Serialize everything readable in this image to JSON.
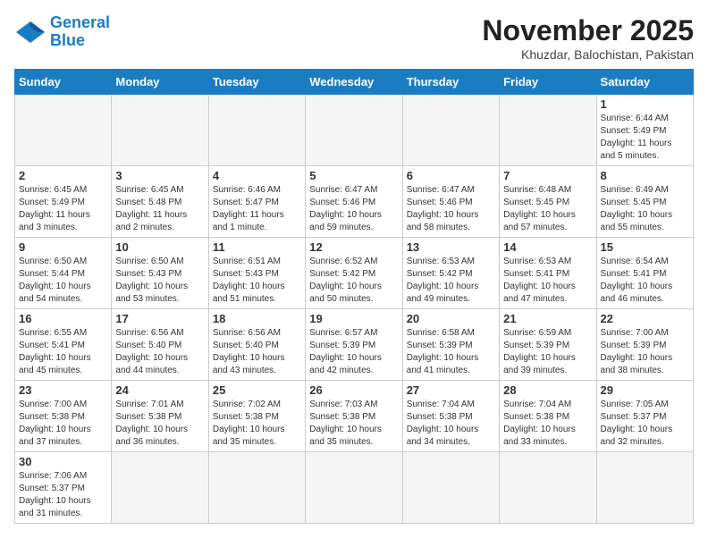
{
  "header": {
    "logo_general": "General",
    "logo_blue": "Blue",
    "month_title": "November 2025",
    "location": "Khuzdar, Balochistan, Pakistan"
  },
  "weekdays": [
    "Sunday",
    "Monday",
    "Tuesday",
    "Wednesday",
    "Thursday",
    "Friday",
    "Saturday"
  ],
  "weeks": [
    [
      {
        "day": "",
        "info": ""
      },
      {
        "day": "",
        "info": ""
      },
      {
        "day": "",
        "info": ""
      },
      {
        "day": "",
        "info": ""
      },
      {
        "day": "",
        "info": ""
      },
      {
        "day": "",
        "info": ""
      },
      {
        "day": "1",
        "info": "Sunrise: 6:44 AM\nSunset: 5:49 PM\nDaylight: 11 hours\nand 5 minutes."
      }
    ],
    [
      {
        "day": "2",
        "info": "Sunrise: 6:45 AM\nSunset: 5:49 PM\nDaylight: 11 hours\nand 3 minutes."
      },
      {
        "day": "3",
        "info": "Sunrise: 6:45 AM\nSunset: 5:48 PM\nDaylight: 11 hours\nand 2 minutes."
      },
      {
        "day": "4",
        "info": "Sunrise: 6:46 AM\nSunset: 5:47 PM\nDaylight: 11 hours\nand 1 minute."
      },
      {
        "day": "5",
        "info": "Sunrise: 6:47 AM\nSunset: 5:46 PM\nDaylight: 10 hours\nand 59 minutes."
      },
      {
        "day": "6",
        "info": "Sunrise: 6:47 AM\nSunset: 5:46 PM\nDaylight: 10 hours\nand 58 minutes."
      },
      {
        "day": "7",
        "info": "Sunrise: 6:48 AM\nSunset: 5:45 PM\nDaylight: 10 hours\nand 57 minutes."
      },
      {
        "day": "8",
        "info": "Sunrise: 6:49 AM\nSunset: 5:45 PM\nDaylight: 10 hours\nand 55 minutes."
      }
    ],
    [
      {
        "day": "9",
        "info": "Sunrise: 6:50 AM\nSunset: 5:44 PM\nDaylight: 10 hours\nand 54 minutes."
      },
      {
        "day": "10",
        "info": "Sunrise: 6:50 AM\nSunset: 5:43 PM\nDaylight: 10 hours\nand 53 minutes."
      },
      {
        "day": "11",
        "info": "Sunrise: 6:51 AM\nSunset: 5:43 PM\nDaylight: 10 hours\nand 51 minutes."
      },
      {
        "day": "12",
        "info": "Sunrise: 6:52 AM\nSunset: 5:42 PM\nDaylight: 10 hours\nand 50 minutes."
      },
      {
        "day": "13",
        "info": "Sunrise: 6:53 AM\nSunset: 5:42 PM\nDaylight: 10 hours\nand 49 minutes."
      },
      {
        "day": "14",
        "info": "Sunrise: 6:53 AM\nSunset: 5:41 PM\nDaylight: 10 hours\nand 47 minutes."
      },
      {
        "day": "15",
        "info": "Sunrise: 6:54 AM\nSunset: 5:41 PM\nDaylight: 10 hours\nand 46 minutes."
      }
    ],
    [
      {
        "day": "16",
        "info": "Sunrise: 6:55 AM\nSunset: 5:41 PM\nDaylight: 10 hours\nand 45 minutes."
      },
      {
        "day": "17",
        "info": "Sunrise: 6:56 AM\nSunset: 5:40 PM\nDaylight: 10 hours\nand 44 minutes."
      },
      {
        "day": "18",
        "info": "Sunrise: 6:56 AM\nSunset: 5:40 PM\nDaylight: 10 hours\nand 43 minutes."
      },
      {
        "day": "19",
        "info": "Sunrise: 6:57 AM\nSunset: 5:39 PM\nDaylight: 10 hours\nand 42 minutes."
      },
      {
        "day": "20",
        "info": "Sunrise: 6:58 AM\nSunset: 5:39 PM\nDaylight: 10 hours\nand 41 minutes."
      },
      {
        "day": "21",
        "info": "Sunrise: 6:59 AM\nSunset: 5:39 PM\nDaylight: 10 hours\nand 39 minutes."
      },
      {
        "day": "22",
        "info": "Sunrise: 7:00 AM\nSunset: 5:39 PM\nDaylight: 10 hours\nand 38 minutes."
      }
    ],
    [
      {
        "day": "23",
        "info": "Sunrise: 7:00 AM\nSunset: 5:38 PM\nDaylight: 10 hours\nand 37 minutes."
      },
      {
        "day": "24",
        "info": "Sunrise: 7:01 AM\nSunset: 5:38 PM\nDaylight: 10 hours\nand 36 minutes."
      },
      {
        "day": "25",
        "info": "Sunrise: 7:02 AM\nSunset: 5:38 PM\nDaylight: 10 hours\nand 35 minutes."
      },
      {
        "day": "26",
        "info": "Sunrise: 7:03 AM\nSunset: 5:38 PM\nDaylight: 10 hours\nand 35 minutes."
      },
      {
        "day": "27",
        "info": "Sunrise: 7:04 AM\nSunset: 5:38 PM\nDaylight: 10 hours\nand 34 minutes."
      },
      {
        "day": "28",
        "info": "Sunrise: 7:04 AM\nSunset: 5:38 PM\nDaylight: 10 hours\nand 33 minutes."
      },
      {
        "day": "29",
        "info": "Sunrise: 7:05 AM\nSunset: 5:37 PM\nDaylight: 10 hours\nand 32 minutes."
      }
    ],
    [
      {
        "day": "30",
        "info": "Sunrise: 7:06 AM\nSunset: 5:37 PM\nDaylight: 10 hours\nand 31 minutes."
      },
      {
        "day": "",
        "info": ""
      },
      {
        "day": "",
        "info": ""
      },
      {
        "day": "",
        "info": ""
      },
      {
        "day": "",
        "info": ""
      },
      {
        "day": "",
        "info": ""
      },
      {
        "day": "",
        "info": ""
      }
    ]
  ]
}
